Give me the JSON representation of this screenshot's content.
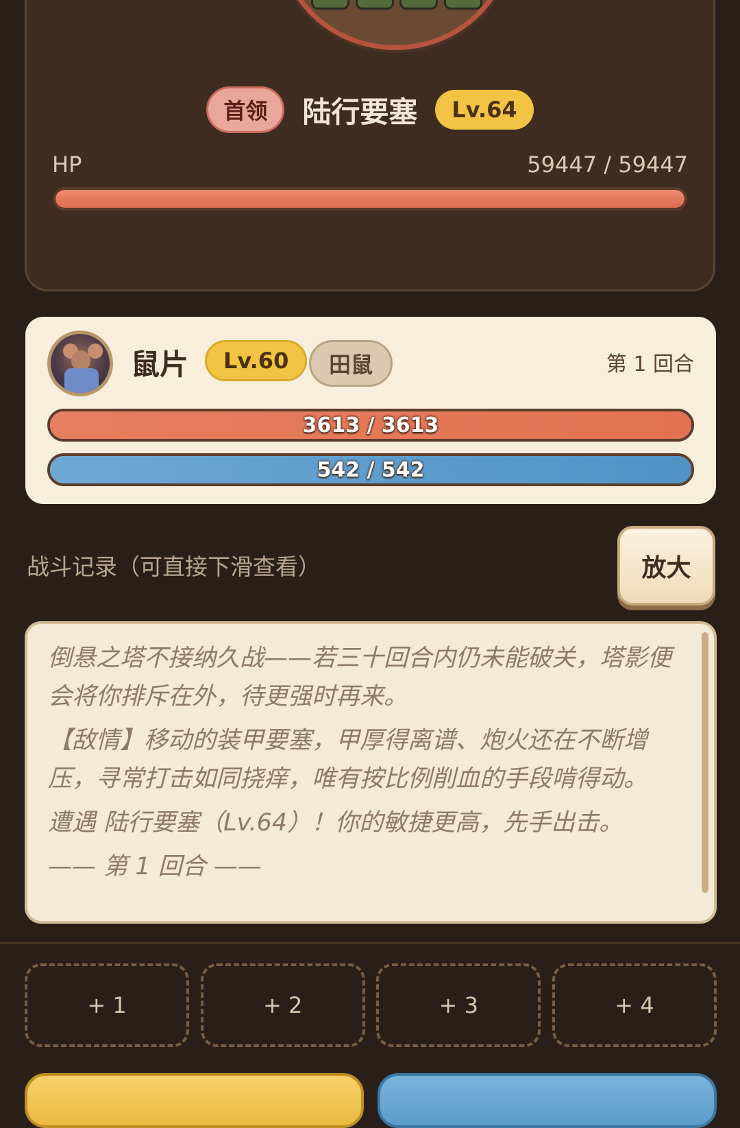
{
  "enemy": {
    "tag": "首领",
    "name": "陆行要塞",
    "level": "Lv.64",
    "hp_label": "HP",
    "hp_text": "59447 / 59447",
    "hp_fraction": 1.0
  },
  "player": {
    "name": "鼠片",
    "level": "Lv.60",
    "class": "田鼠",
    "round": "第 1 回合",
    "hp_text": "3613 / 3613",
    "hp_fraction": 1.0,
    "mp_text": "542 / 542",
    "mp_fraction": 1.0
  },
  "log": {
    "title": "战斗记录（可直接下滑查看）",
    "zoom_label": "放大",
    "lines": [
      "倒悬之塔不接纳久战——若三十回合内仍未能破关，塔影便会将你排斥在外，待更强时再来。",
      "【敌情】移动的装甲要塞，甲厚得离谱、炮火还在不断增压，寻常打击如同挠痒，唯有按比例削血的手段啃得动。",
      "遭遇 陆行要塞（Lv.64）！你的敏捷更高，先手出击。",
      "—— 第 1 回合 ——"
    ]
  },
  "slots": [
    "+ 1",
    "+ 2",
    "+ 3",
    "+ 4"
  ],
  "colors": {
    "background": "#2a1f18",
    "enemy_hp": "#e2704f",
    "player_hp": "#e47252",
    "player_mp": "#4f93c7",
    "level_badge": "#f3c444"
  }
}
